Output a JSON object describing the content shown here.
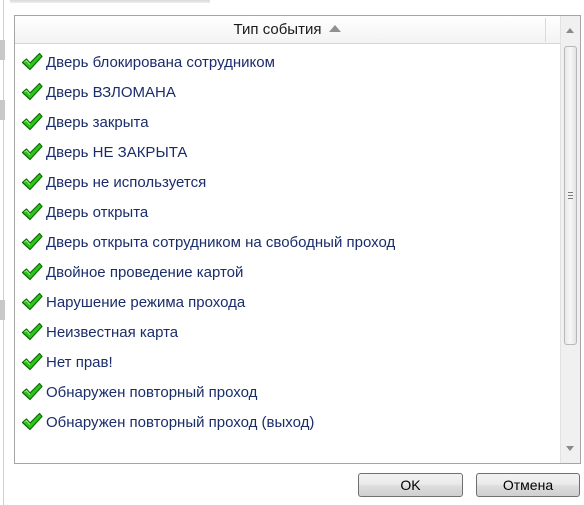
{
  "dialog": {
    "column_header": "Тип события",
    "sort_direction": "ascending",
    "rows": [
      {
        "icon": "checkmark-icon",
        "label": "Дверь блокирована сотрудником"
      },
      {
        "icon": "checkmark-icon",
        "label": "Дверь ВЗЛОМАНА"
      },
      {
        "icon": "checkmark-icon",
        "label": "Дверь закрыта"
      },
      {
        "icon": "checkmark-icon",
        "label": "Дверь НЕ ЗАКРЫТА"
      },
      {
        "icon": "checkmark-icon",
        "label": "Дверь не используется"
      },
      {
        "icon": "checkmark-icon",
        "label": "Дверь открыта"
      },
      {
        "icon": "checkmark-icon",
        "label": "Дверь открыта сотрудником на свободный проход"
      },
      {
        "icon": "checkmark-icon",
        "label": "Двойное проведение картой"
      },
      {
        "icon": "checkmark-icon",
        "label": "Нарушение режима прохода"
      },
      {
        "icon": "checkmark-icon",
        "label": "Неизвестная карта"
      },
      {
        "icon": "checkmark-icon",
        "label": "Нет прав!"
      },
      {
        "icon": "checkmark-icon",
        "label": "Обнаружен повторный проход"
      },
      {
        "icon": "checkmark-icon",
        "label": "Обнаружен повторный проход (выход)"
      }
    ],
    "buttons": {
      "ok_label": "OK",
      "cancel_label": "Отмена"
    }
  },
  "colors": {
    "row_text": "#1a2d6b",
    "check_fill": "#2fc21b",
    "check_outline": "#0e6b06",
    "grid_border": "#a5a5a5"
  }
}
